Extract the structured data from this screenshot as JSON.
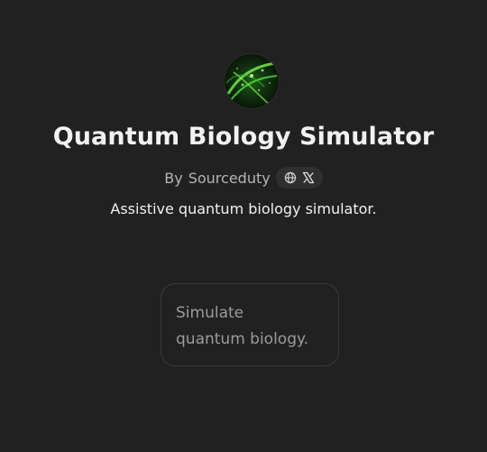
{
  "gpt": {
    "avatar_icon": "green-helix-avatar",
    "title": "Quantum Biology Simulator",
    "byline_prefix": "By",
    "author": "Sourceduty",
    "social_icons": [
      "globe-icon",
      "x-logo-icon"
    ],
    "description": "Assistive quantum biology simulator."
  },
  "starters": [
    {
      "line1": "Simulate",
      "line2": "quantum biology."
    }
  ],
  "colors": {
    "background": "#212121",
    "title": "#f2f2f2",
    "muted": "#b4b4b4",
    "card_border": "#3a3a3a",
    "card_text": "#9b9b9b",
    "accent_green": "#35d12a"
  }
}
